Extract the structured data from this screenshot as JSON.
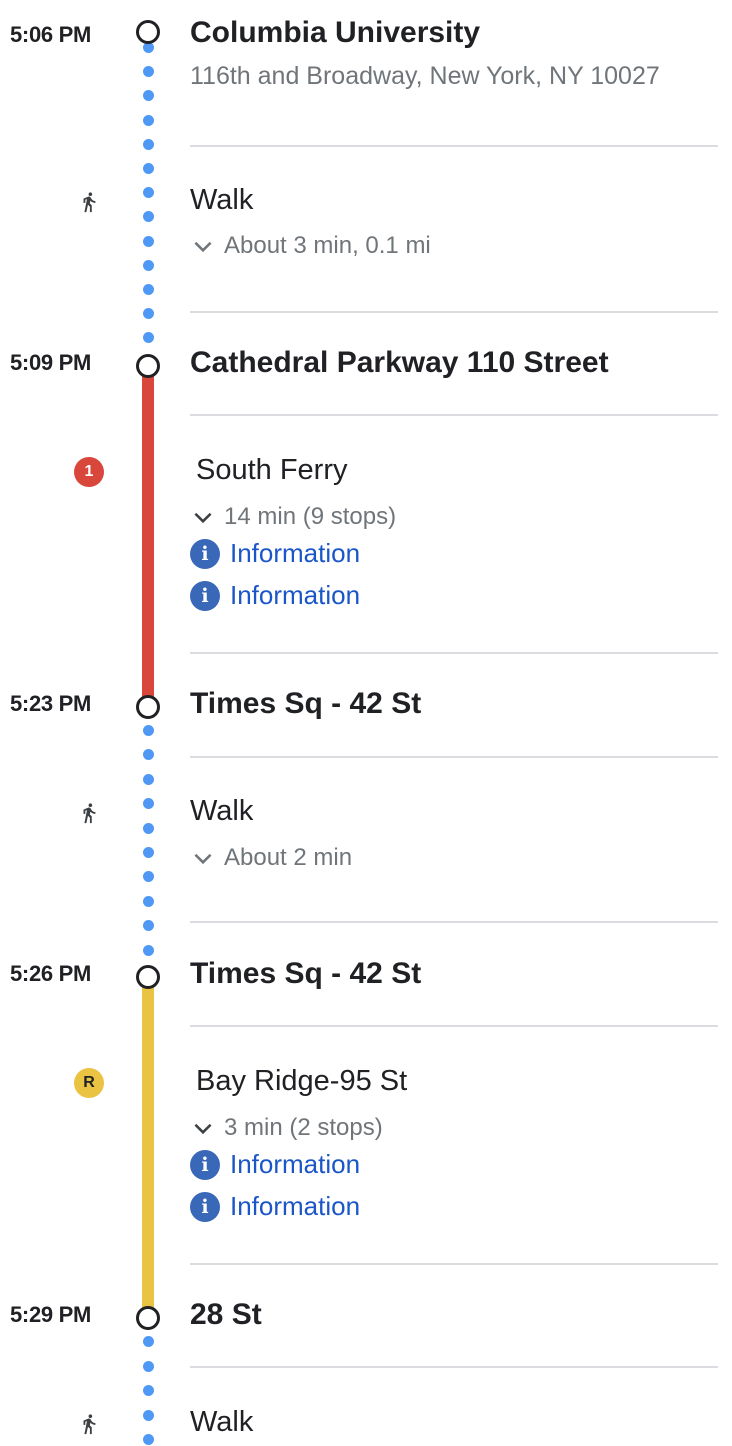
{
  "colors": {
    "walk_dots": "#4f98f3",
    "route_1": "#d9463c",
    "route_r": "#ebc342",
    "info_link": "#1a56c8",
    "info_icon": "#3a68b8"
  },
  "steps": [
    {
      "time": "5:06 PM",
      "name": "Columbia University",
      "address": "116th and Broadway, New York, NY 10027"
    },
    {
      "mode": "Walk",
      "icon": "walk-icon",
      "detail": "About 3 min, 0.1 mi"
    },
    {
      "time": "5:09 PM",
      "name": "Cathedral Parkway 110 Street"
    },
    {
      "route_badge": "1",
      "headsign": "South Ferry",
      "detail": "14 min (9 stops)",
      "links": [
        "Information",
        "Information"
      ]
    },
    {
      "time": "5:23 PM",
      "name": "Times Sq - 42 St"
    },
    {
      "mode": "Walk",
      "icon": "walk-icon",
      "detail": "About 2 min"
    },
    {
      "time": "5:26 PM",
      "name": "Times Sq - 42 St"
    },
    {
      "route_badge": "R",
      "headsign": "Bay Ridge-95 St",
      "detail": "3 min (2 stops)",
      "links": [
        "Information",
        "Information"
      ]
    },
    {
      "time": "5:29 PM",
      "name": "28 St"
    },
    {
      "mode": "Walk",
      "icon": "walk-icon"
    }
  ]
}
